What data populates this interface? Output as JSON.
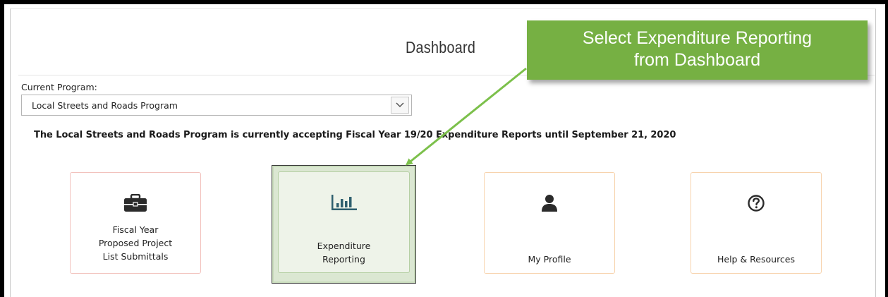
{
  "page": {
    "title": "Dashboard"
  },
  "program": {
    "label": "Current Program:",
    "selected": "Local Streets and Roads Program"
  },
  "notice": "The Local Streets and Roads Program is currently accepting Fiscal Year 19/20 Expenditure Reports until September 21, 2020",
  "tiles": [
    {
      "icon": "briefcase-icon",
      "line1": "Fiscal Year",
      "line2": "Proposed Project",
      "line3": "List Submittals"
    },
    {
      "icon": "bar-chart-icon",
      "line1": "Expenditure",
      "line2": "Reporting"
    },
    {
      "icon": "user-icon",
      "line1": "My Profile"
    },
    {
      "icon": "help-icon",
      "line1": "Help & Resources"
    }
  ],
  "callout": {
    "line1": "Select Expenditure Reporting",
    "line2": "from Dashboard"
  },
  "colors": {
    "callout": "#76b043",
    "highlight_border": "#3b3b3b",
    "highlight_fill": "#dbe7d2"
  }
}
